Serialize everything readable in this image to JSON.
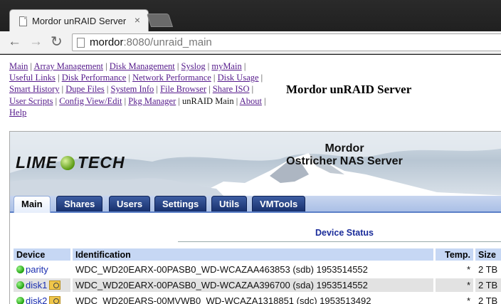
{
  "browser": {
    "tab_title": "Mordor unRAID Server",
    "tab_close": "×",
    "url_host": "mordor",
    "url_rest": ":8080/unraid_main",
    "icons": {
      "back": "arrow-left-icon",
      "forward": "arrow-right-icon",
      "reload": "reload-icon"
    }
  },
  "topnav": {
    "links": [
      "Main",
      "Array Management",
      "Disk Management",
      "Syslog",
      "myMain",
      "Useful Links",
      "Disk Performance",
      "Network Performance",
      "Disk Usage",
      "Smart History",
      "Dupe Files",
      "System Info",
      "File Browser",
      "Share ISO",
      "User Scripts",
      "Config View/Edit",
      "Pkg Manager",
      "unRAID Main",
      "About",
      "Help"
    ],
    "separator": " | ",
    "current": "unRAID Main"
  },
  "server_title": "Mordor unRAID Server",
  "banner": {
    "logo_left": "LIME",
    "logo_right": "TECH",
    "title_line1": "Mordor",
    "title_line2": "Ostricher NAS Server"
  },
  "tabs": [
    "Main",
    "Shares",
    "Users",
    "Settings",
    "Utils",
    "VMTools"
  ],
  "active_tab": "Main",
  "device_status": {
    "title": "Device Status",
    "headers": {
      "device": "Device",
      "identification": "Identification",
      "temp": "Temp.",
      "size": "Size"
    },
    "rows": [
      {
        "device": "parity",
        "identification": "WDC_WD20EARX-00PASB0_WD-WCAZAA463853 (sdb) 1953514552",
        "temp": "*",
        "size": "2 TB",
        "status_color": "#1fa20e"
      },
      {
        "device": "disk1",
        "identification": "WDC_WD20EARX-00PASB0_WD-WCAZAA396700 (sda) 1953514552",
        "temp": "*",
        "size": "2 TB",
        "status_color": "#1fa20e"
      },
      {
        "device": "disk2",
        "identification": "WDC_WD20EARS-00MVWB0_WD-WCAZA1318851 (sdc) 1953513492",
        "temp": "*",
        "size": "2 TB",
        "status_color": "#1fa20e"
      }
    ]
  },
  "colors": {
    "accent": "#18306d",
    "header_bg": "#c6d7f4",
    "link": "#551a8b"
  }
}
